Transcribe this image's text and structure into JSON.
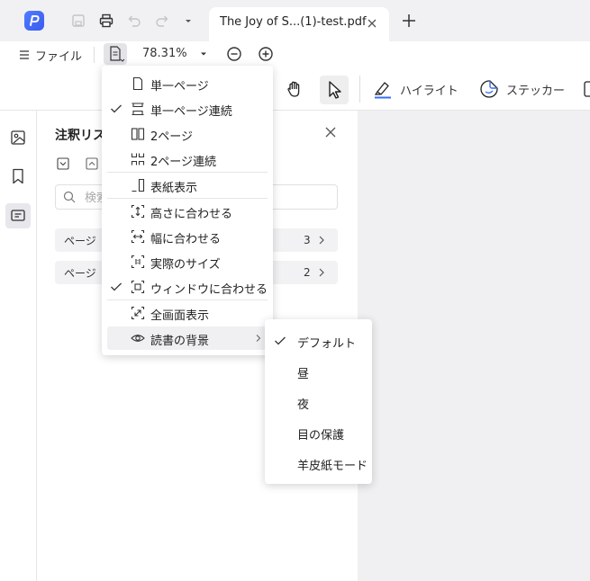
{
  "tab": {
    "title": "The Joy of S...(1)-test.pdf"
  },
  "toolbar": {
    "file_label": "ファイル",
    "zoom_value": "78.31%",
    "highlight_label": "ハイライト",
    "sticker_label": "ステッカー"
  },
  "panel": {
    "title": "注釈リス",
    "search_placeholder": "検索",
    "pages": [
      {
        "label": "ページ",
        "count": "3"
      },
      {
        "label": "ページ",
        "count": "2"
      }
    ]
  },
  "view_menu": {
    "items": [
      {
        "label": "単一ページ",
        "checked": false
      },
      {
        "label": "単一ページ連続",
        "checked": true
      },
      {
        "label": "2ページ",
        "checked": false
      },
      {
        "label": "2ページ連続",
        "checked": false
      },
      {
        "label": "表紙表示",
        "checked": false
      },
      {
        "label": "高さに合わせる",
        "checked": false
      },
      {
        "label": "幅に合わせる",
        "checked": false
      },
      {
        "label": "実際のサイズ",
        "checked": false
      },
      {
        "label": "ウィンドウに合わせる",
        "checked": true
      },
      {
        "label": "全画面表示",
        "checked": false
      },
      {
        "label": "読書の背景",
        "checked": false
      }
    ]
  },
  "background_menu": {
    "items": [
      {
        "label": "デフォルト",
        "checked": true
      },
      {
        "label": "昼",
        "checked": false
      },
      {
        "label": "夜",
        "checked": false
      },
      {
        "label": "目の保護",
        "checked": false
      },
      {
        "label": "羊皮紙モード",
        "checked": false
      }
    ]
  },
  "colors": {
    "accent": "#3a5bf0",
    "highlight_underline": "#3a6cf4"
  }
}
